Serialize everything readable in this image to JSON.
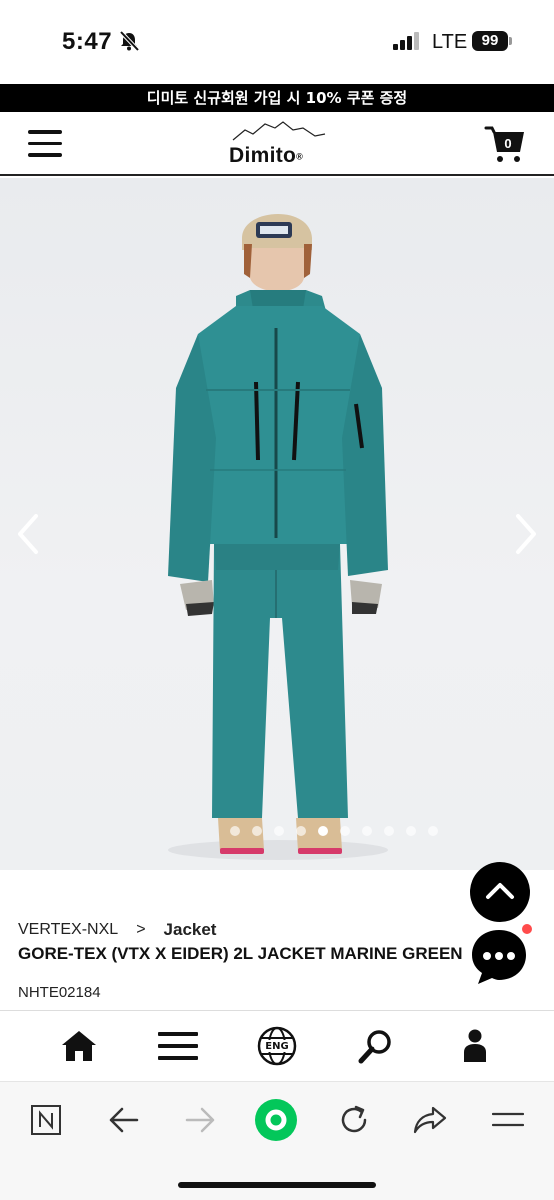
{
  "status_bar": {
    "time": "5:47",
    "network": "LTE",
    "battery": "99"
  },
  "promo_banner": {
    "text": "디미토 신규회원 가입 시 10% 쿠폰 증정"
  },
  "header": {
    "logo_text": "Dimito",
    "logo_mark": "®",
    "cart_count": "0"
  },
  "hero": {
    "slide_count": 10,
    "active_slide": 5
  },
  "product": {
    "breadcrumb": {
      "brand": "VERTEX-NXL",
      "separator": ">",
      "category": "Jacket"
    },
    "title": "GORE-TEX (VTX X EIDER) 2L JACKET MARINE GREEN",
    "code": "NHTE02184"
  },
  "site_nav": {
    "language_label": "ENG",
    "icons": [
      "home-icon",
      "menu-icon",
      "language-globe-icon",
      "search-icon",
      "account-icon"
    ]
  },
  "browser_toolbar": {
    "icons": [
      "naver-n-icon",
      "back-arrow-icon",
      "forward-arrow-icon",
      "green-home-icon",
      "reload-icon",
      "share-icon",
      "menu-icon"
    ]
  },
  "colors": {
    "banner_bg": "#000000",
    "jacket_teal": "#2e8e90",
    "nav_green": "#03c75a",
    "notification_red": "#ff4b4b"
  }
}
